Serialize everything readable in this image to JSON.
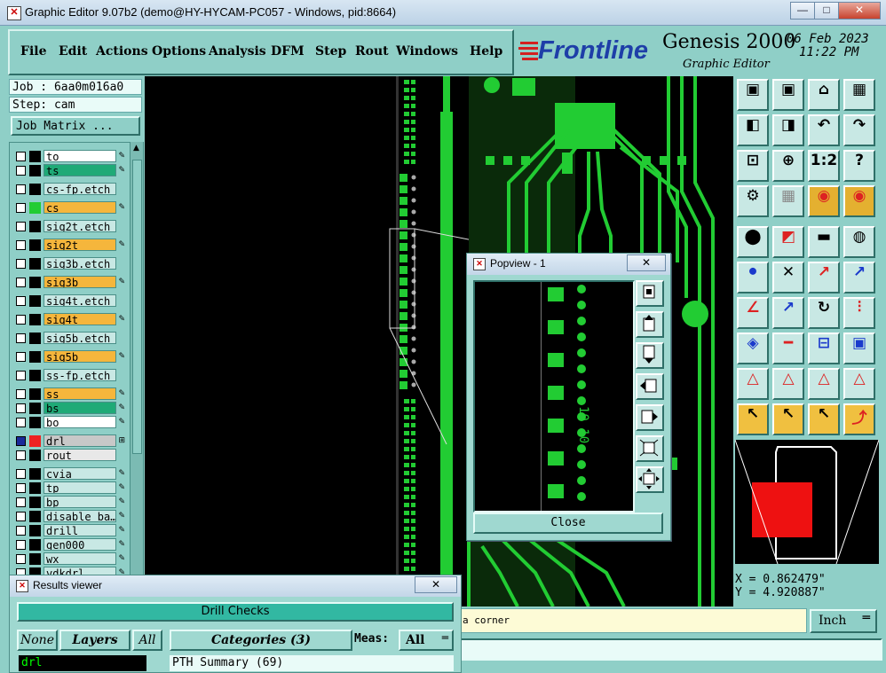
{
  "window": {
    "title": "Graphic Editor 9.07b2 (demo@HY-HYCAM-PC057 - Windows, pid:8664)",
    "minimize": "—",
    "maximize": "□",
    "close": "✕"
  },
  "menu": [
    "File",
    "Edit",
    "Actions",
    "Options",
    "Analysis",
    "DFM",
    "Step",
    "Rout",
    "Windows",
    "Help"
  ],
  "brand": {
    "logo": "Frontline",
    "product": "Genesis 2000",
    "subtitle": "Graphic Editor",
    "date": "06 Feb 2023",
    "time": "11:22 PM"
  },
  "job": {
    "job_label": "Job : 6aa0m016a0",
    "step_label": "Step: cam",
    "matrix_button": "Job Matrix ..."
  },
  "layers": [
    {
      "name": "to",
      "color": "#ffffff",
      "swatch": ""
    },
    {
      "name": "ts",
      "color": "#1faa77",
      "swatch": ""
    },
    {
      "name": "cs-fp.etch",
      "color": "#c8e8e4",
      "swatch": ""
    },
    {
      "name": "cs",
      "color": "#f5b63c",
      "swatch": "#22cc33"
    },
    {
      "name": "sig2t.etch",
      "color": "#c8e8e4",
      "swatch": ""
    },
    {
      "name": "sig2t",
      "color": "#f5b63c",
      "swatch": ""
    },
    {
      "name": "sig3b.etch",
      "color": "#c8e8e4",
      "swatch": ""
    },
    {
      "name": "sig3b",
      "color": "#f5b63c",
      "swatch": ""
    },
    {
      "name": "sig4t.etch",
      "color": "#c8e8e4",
      "swatch": ""
    },
    {
      "name": "sig4t",
      "color": "#f5b63c",
      "swatch": ""
    },
    {
      "name": "sig5b.etch",
      "color": "#c8e8e4",
      "swatch": ""
    },
    {
      "name": "sig5b",
      "color": "#f5b63c",
      "swatch": ""
    },
    {
      "name": "ss-fp.etch",
      "color": "#c8e8e4",
      "swatch": ""
    },
    {
      "name": "ss",
      "color": "#f5b63c",
      "swatch": ""
    },
    {
      "name": "bs",
      "color": "#1faa77",
      "swatch": ""
    },
    {
      "name": "bo",
      "color": "#ffffff",
      "swatch": ""
    },
    {
      "name": "drl",
      "color": "#c8c8c8",
      "swatch": "#ee2222"
    },
    {
      "name": "rout",
      "color": "#e8e8e8",
      "swatch": ""
    },
    {
      "name": "cvia",
      "color": "#c8e8e4",
      "swatch": ""
    },
    {
      "name": "tp",
      "color": "#c8e8e4",
      "swatch": ""
    },
    {
      "name": "bp",
      "color": "#c8e8e4",
      "swatch": ""
    },
    {
      "name": "disable_ba…",
      "color": "#c8e8e4",
      "swatch": ""
    },
    {
      "name": "drill",
      "color": "#c8e8e4",
      "swatch": ""
    },
    {
      "name": "gen000",
      "color": "#c8e8e4",
      "swatch": ""
    },
    {
      "name": "wx",
      "color": "#c8e8e4",
      "swatch": ""
    },
    {
      "name": "vdkdrl",
      "color": "#c8e8e4",
      "swatch": ""
    }
  ],
  "popview": {
    "title": "Popview - 1",
    "close_x": "✕",
    "close_label": "Close",
    "silk_text": "10 10"
  },
  "results": {
    "title": "Results viewer",
    "close_x": "✕",
    "header": "Drill Checks",
    "none": "None",
    "layers": "Layers",
    "all": "All",
    "categories": "Categories (3)",
    "meas_label": "Meas:",
    "meas_value": "All",
    "layer_field": "drl",
    "summary": "PTH Summary (69)"
  },
  "coords": {
    "x": "X = 0.862479\"",
    "y": "Y = 4.920887\""
  },
  "status": {
    "text": "a corner",
    "units": "Inch"
  },
  "tools": [
    "step-up-icon",
    "step-down-icon",
    "home-icon",
    "grid-snap-icon",
    "pan-left-icon",
    "pan-right-icon",
    "undo-icon",
    "redo-icon",
    "zoom-fit-icon",
    "zoom-in-icon",
    "scale-1-2-icon",
    "help-icon",
    "properties-icon",
    "grid-icon",
    "layer-colors-icon",
    "layer-colors-2-icon",
    "point-select-icon",
    "highlight-icon",
    "ruler-icon",
    "snap-center-icon",
    "connect-icon",
    "cross-icon",
    "line-node-icon",
    "line-arc-icon",
    "angle-icon",
    "line-measure-icon",
    "rotate-icon",
    "fan-icon",
    "pad-icon",
    "horizontal-icon",
    "dimension-icon",
    "component-icon",
    "tri-a-icon",
    "tri-b-icon",
    "tri-c-icon",
    "tri-d-icon",
    "pointer-icon",
    "pointer-2-icon",
    "pointer-3-icon",
    "route-icon"
  ]
}
